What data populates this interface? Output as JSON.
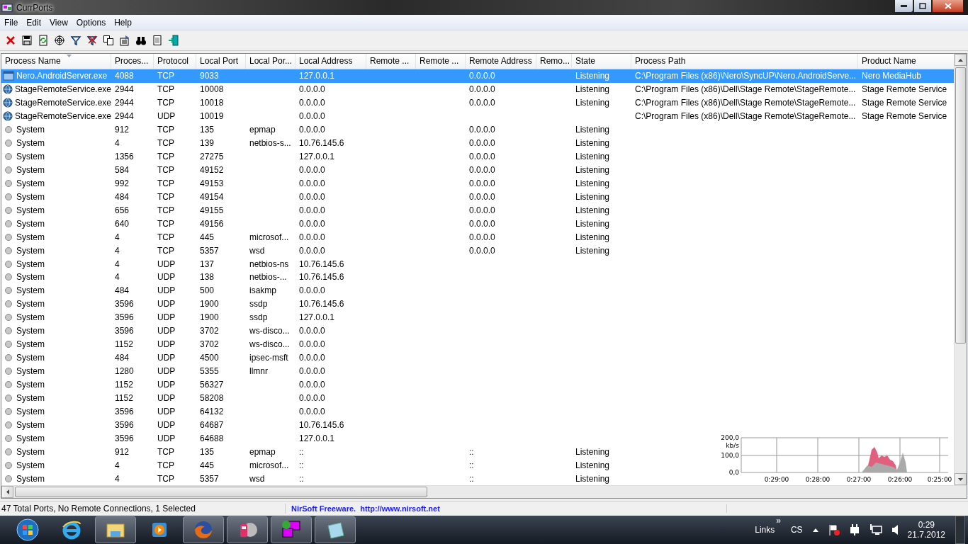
{
  "window": {
    "title": "CurrPorts"
  },
  "menu": [
    "File",
    "Edit",
    "View",
    "Options",
    "Help"
  ],
  "table": {
    "columns": [
      {
        "label": "Process Name",
        "sorted": true
      },
      {
        "label": "Proces...",
        "sorted": false
      },
      {
        "label": "Protocol",
        "sorted": false
      },
      {
        "label": "Local Port",
        "sorted": false
      },
      {
        "label": "Local Por...",
        "sorted": false
      },
      {
        "label": "Local Address",
        "sorted": false
      },
      {
        "label": "Remote ...",
        "sorted": false
      },
      {
        "label": "Remote ...",
        "sorted": false
      },
      {
        "label": "Remote Address",
        "sorted": false
      },
      {
        "label": "Remo...",
        "sorted": false
      },
      {
        "label": "State",
        "sorted": false
      },
      {
        "label": "Process Path",
        "sorted": false
      },
      {
        "label": "Product Name",
        "sorted": false
      }
    ],
    "rows": [
      {
        "kind": "app",
        "selected": true,
        "cells": [
          "Nero.AndroidServer.exe",
          "4088",
          "TCP",
          "9033",
          null,
          "127.0.0.1",
          null,
          null,
          "0.0.0.0",
          null,
          "Listening",
          "C:\\Program Files (x86)\\Nero\\SyncUP\\Nero.AndroidServe...",
          "Nero MediaHub"
        ]
      },
      {
        "kind": "service",
        "selected": false,
        "cells": [
          "StageRemoteService.exe",
          "2944",
          "TCP",
          "10008",
          null,
          "0.0.0.0",
          null,
          null,
          "0.0.0.0",
          null,
          "Listening",
          "C:\\Program Files (x86)\\Dell\\Stage Remote\\StageRemote...",
          "Stage Remote Service"
        ]
      },
      {
        "kind": "service",
        "selected": false,
        "cells": [
          "StageRemoteService.exe",
          "2944",
          "TCP",
          "10018",
          null,
          "0.0.0.0",
          null,
          null,
          "0.0.0.0",
          null,
          "Listening",
          "C:\\Program Files (x86)\\Dell\\Stage Remote\\StageRemote...",
          "Stage Remote Service"
        ]
      },
      {
        "kind": "service",
        "selected": false,
        "cells": [
          "StageRemoteService.exe",
          "2944",
          "UDP",
          "10019",
          null,
          "0.0.0.0",
          null,
          null,
          null,
          null,
          null,
          "C:\\Program Files (x86)\\Dell\\Stage Remote\\StageRemote...",
          "Stage Remote Service"
        ]
      },
      {
        "kind": "system",
        "selected": false,
        "cells": [
          "System",
          "912",
          "TCP",
          "135",
          "epmap",
          "0.0.0.0",
          null,
          null,
          "0.0.0.0",
          null,
          "Listening",
          null,
          null
        ]
      },
      {
        "kind": "system",
        "selected": false,
        "cells": [
          "System",
          "4",
          "TCP",
          "139",
          "netbios-s...",
          "10.76.145.6",
          null,
          null,
          "0.0.0.0",
          null,
          "Listening",
          null,
          null
        ]
      },
      {
        "kind": "system",
        "selected": false,
        "cells": [
          "System",
          "1356",
          "TCP",
          "27275",
          null,
          "127.0.0.1",
          null,
          null,
          "0.0.0.0",
          null,
          "Listening",
          null,
          null
        ]
      },
      {
        "kind": "system",
        "selected": false,
        "cells": [
          "System",
          "584",
          "TCP",
          "49152",
          null,
          "0.0.0.0",
          null,
          null,
          "0.0.0.0",
          null,
          "Listening",
          null,
          null
        ]
      },
      {
        "kind": "system",
        "selected": false,
        "cells": [
          "System",
          "992",
          "TCP",
          "49153",
          null,
          "0.0.0.0",
          null,
          null,
          "0.0.0.0",
          null,
          "Listening",
          null,
          null
        ]
      },
      {
        "kind": "system",
        "selected": false,
        "cells": [
          "System",
          "484",
          "TCP",
          "49154",
          null,
          "0.0.0.0",
          null,
          null,
          "0.0.0.0",
          null,
          "Listening",
          null,
          null
        ]
      },
      {
        "kind": "system",
        "selected": false,
        "cells": [
          "System",
          "656",
          "TCP",
          "49155",
          null,
          "0.0.0.0",
          null,
          null,
          "0.0.0.0",
          null,
          "Listening",
          null,
          null
        ]
      },
      {
        "kind": "system",
        "selected": false,
        "cells": [
          "System",
          "640",
          "TCP",
          "49156",
          null,
          "0.0.0.0",
          null,
          null,
          "0.0.0.0",
          null,
          "Listening",
          null,
          null
        ]
      },
      {
        "kind": "system",
        "selected": false,
        "cells": [
          "System",
          "4",
          "TCP",
          "445",
          "microsof...",
          "0.0.0.0",
          null,
          null,
          "0.0.0.0",
          null,
          "Listening",
          null,
          null
        ]
      },
      {
        "kind": "system",
        "selected": false,
        "cells": [
          "System",
          "4",
          "TCP",
          "5357",
          "wsd",
          "0.0.0.0",
          null,
          null,
          "0.0.0.0",
          null,
          "Listening",
          null,
          null
        ]
      },
      {
        "kind": "system",
        "selected": false,
        "cells": [
          "System",
          "4",
          "UDP",
          "137",
          "netbios-ns",
          "10.76.145.6",
          null,
          null,
          null,
          null,
          null,
          null,
          null
        ]
      },
      {
        "kind": "system",
        "selected": false,
        "cells": [
          "System",
          "4",
          "UDP",
          "138",
          "netbios-...",
          "10.76.145.6",
          null,
          null,
          null,
          null,
          null,
          null,
          null
        ]
      },
      {
        "kind": "system",
        "selected": false,
        "cells": [
          "System",
          "484",
          "UDP",
          "500",
          "isakmp",
          "0.0.0.0",
          null,
          null,
          null,
          null,
          null,
          null,
          null
        ]
      },
      {
        "kind": "system",
        "selected": false,
        "cells": [
          "System",
          "3596",
          "UDP",
          "1900",
          "ssdp",
          "10.76.145.6",
          null,
          null,
          null,
          null,
          null,
          null,
          null
        ]
      },
      {
        "kind": "system",
        "selected": false,
        "cells": [
          "System",
          "3596",
          "UDP",
          "1900",
          "ssdp",
          "127.0.0.1",
          null,
          null,
          null,
          null,
          null,
          null,
          null
        ]
      },
      {
        "kind": "system",
        "selected": false,
        "cells": [
          "System",
          "3596",
          "UDP",
          "3702",
          "ws-disco...",
          "0.0.0.0",
          null,
          null,
          null,
          null,
          null,
          null,
          null
        ]
      },
      {
        "kind": "system",
        "selected": false,
        "cells": [
          "System",
          "1152",
          "UDP",
          "3702",
          "ws-disco...",
          "0.0.0.0",
          null,
          null,
          null,
          null,
          null,
          null,
          null
        ]
      },
      {
        "kind": "system",
        "selected": false,
        "cells": [
          "System",
          "484",
          "UDP",
          "4500",
          "ipsec-msft",
          "0.0.0.0",
          null,
          null,
          null,
          null,
          null,
          null,
          null
        ]
      },
      {
        "kind": "system",
        "selected": false,
        "cells": [
          "System",
          "1280",
          "UDP",
          "5355",
          "llmnr",
          "0.0.0.0",
          null,
          null,
          null,
          null,
          null,
          null,
          null
        ]
      },
      {
        "kind": "system",
        "selected": false,
        "cells": [
          "System",
          "1152",
          "UDP",
          "56327",
          null,
          "0.0.0.0",
          null,
          null,
          null,
          null,
          null,
          null,
          null
        ]
      },
      {
        "kind": "system",
        "selected": false,
        "cells": [
          "System",
          "1152",
          "UDP",
          "58208",
          null,
          "0.0.0.0",
          null,
          null,
          null,
          null,
          null,
          null,
          null
        ]
      },
      {
        "kind": "system",
        "selected": false,
        "cells": [
          "System",
          "3596",
          "UDP",
          "64132",
          null,
          "0.0.0.0",
          null,
          null,
          null,
          null,
          null,
          null,
          null
        ]
      },
      {
        "kind": "system",
        "selected": false,
        "cells": [
          "System",
          "3596",
          "UDP",
          "64687",
          null,
          "10.76.145.6",
          null,
          null,
          null,
          null,
          null,
          null,
          null
        ]
      },
      {
        "kind": "system",
        "selected": false,
        "cells": [
          "System",
          "3596",
          "UDP",
          "64688",
          null,
          "127.0.0.1",
          null,
          null,
          null,
          null,
          null,
          null,
          null
        ]
      },
      {
        "kind": "system",
        "selected": false,
        "cells": [
          "System",
          "912",
          "TCP",
          "135",
          "epmap",
          "::",
          null,
          null,
          "::",
          null,
          "Listening",
          null,
          null
        ]
      },
      {
        "kind": "system",
        "selected": false,
        "cells": [
          "System",
          "4",
          "TCP",
          "445",
          "microsof...",
          "::",
          null,
          null,
          "::",
          null,
          "Listening",
          null,
          null
        ]
      },
      {
        "kind": "system",
        "selected": false,
        "cells": [
          "System",
          "4",
          "TCP",
          "5357",
          "wsd",
          "::",
          null,
          null,
          "::",
          null,
          "Listening",
          null,
          null
        ]
      }
    ]
  },
  "traffic_graph": {
    "y_ticks": [
      "200,0",
      "100,0",
      "0,0"
    ],
    "unit": "kb/s",
    "x_ticks": [
      "0:29:00",
      "0:28:00",
      "0:27:00",
      "0:26:00",
      "0:25:00"
    ]
  },
  "status_bar": {
    "summary": "47 Total Ports, No Remote Connections, 1 Selected",
    "credit": "NirSoft Freeware.  http://www.nirsoft.net"
  },
  "taskbar": {
    "links": "Links",
    "chevron": "»",
    "language": "CS",
    "time": "0:29",
    "date": "21.7.2012"
  }
}
